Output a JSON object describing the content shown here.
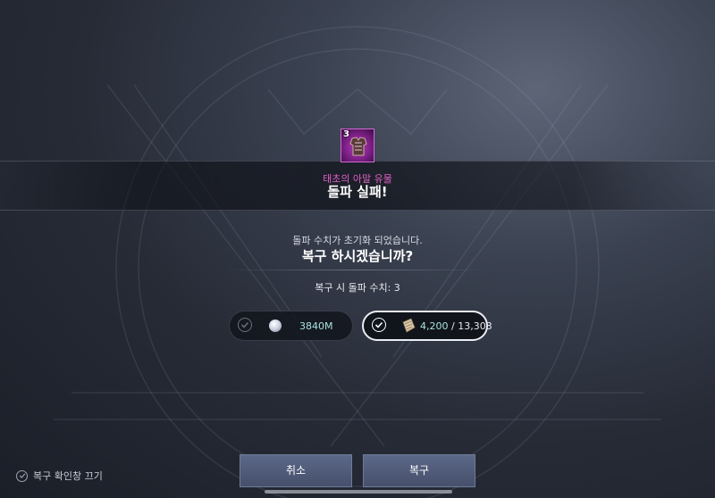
{
  "item": {
    "icon": "armor-icon",
    "level": "3",
    "name": "태초의 아말 유물",
    "rarity_color": "#e05fc6"
  },
  "result": {
    "title": "돌파 실패!"
  },
  "prompt": {
    "message": "돌파 수치가 초기화 되었습니다.",
    "question": "복구 하시겠습니까?",
    "restore_value": "복구 시 돌파 수치: 3"
  },
  "options": {
    "silver": {
      "icon": "silver-coin-icon",
      "amount": "3840M",
      "selected": false
    },
    "scroll": {
      "icon": "scroll-icon",
      "amount": "4,200",
      "separator": " / ",
      "total": "13,303",
      "selected": true
    }
  },
  "buttons": {
    "cancel": "취소",
    "restore": "복구"
  },
  "toggle": {
    "label": "복구 확인창 끄기"
  },
  "colors": {
    "accent": "#a9e2e0",
    "button": "#525d7b"
  }
}
